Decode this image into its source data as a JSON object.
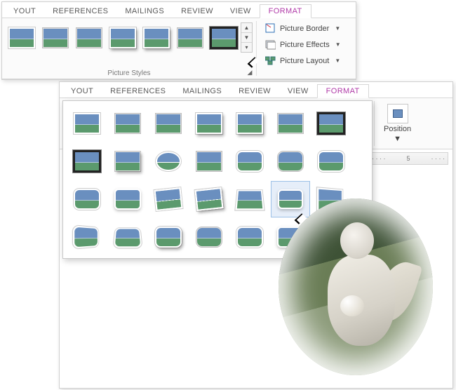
{
  "tabs": {
    "layout": "YOUT",
    "references": "REFERENCES",
    "mailings": "MAILINGS",
    "review": "REVIEW",
    "view": "VIEW",
    "format": "FORMAT"
  },
  "ribbon": {
    "group_label": "Picture Styles",
    "picture_border": "Picture Border",
    "picture_effects": "Picture Effects",
    "picture_layout": "Picture Layout",
    "position": "Position"
  },
  "ruler": {
    "mark": "5"
  }
}
